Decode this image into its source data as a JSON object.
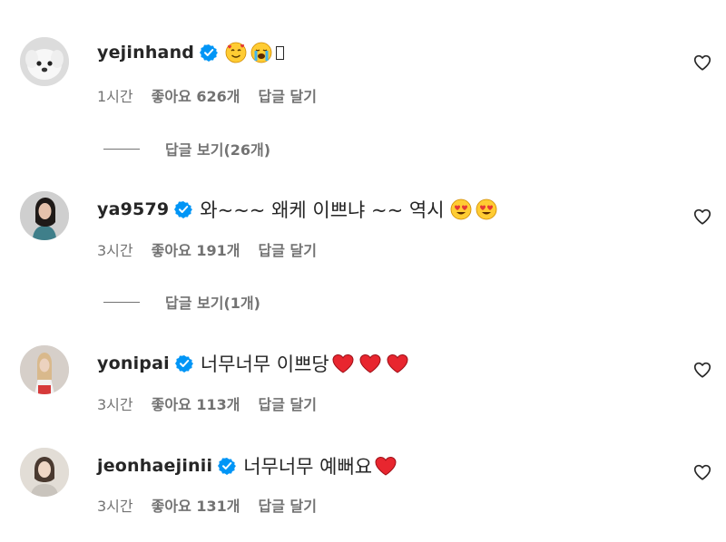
{
  "colors": {
    "text": "#262626",
    "secondary": "#737373",
    "verified": "#0095f6",
    "heart_red": "#ed1c24"
  },
  "comments": [
    {
      "username": "yejinhand",
      "text": "",
      "emojis": [
        "smiling-face-with-hearts",
        "loudly-crying-face",
        "tofu"
      ],
      "time": "1시간",
      "likes": "좋아요 626개",
      "reply_label": "답글 달기",
      "view_replies": "답글 보기(26개)"
    },
    {
      "username": "ya9579",
      "text": "와~~~ 왜케 이쁘냐 ~~ 역시",
      "emojis": [
        "heart-eyes",
        "heart-eyes"
      ],
      "time": "3시간",
      "likes": "좋아요 191개",
      "reply_label": "답글 달기",
      "view_replies": "답글 보기(1개)"
    },
    {
      "username": "yonipai",
      "text": "너무너무 이쁘당",
      "emojis": [
        "red-heart",
        "red-heart",
        "red-heart"
      ],
      "time": "3시간",
      "likes": "좋아요 113개",
      "reply_label": "답글 달기"
    },
    {
      "username": "jeonhaejinii",
      "text": "너무너무 예뻐요",
      "emojis": [
        "red-heart"
      ],
      "time": "3시간",
      "likes": "좋아요 131개",
      "reply_label": "답글 달기"
    }
  ]
}
